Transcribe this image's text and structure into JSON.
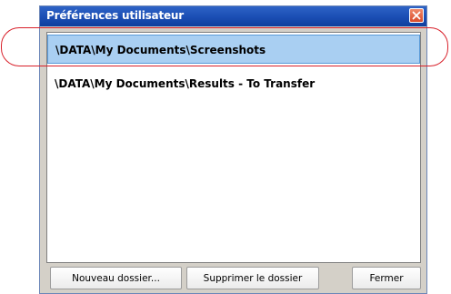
{
  "window": {
    "title": "Préférences utilisateur",
    "close_icon": "close-icon"
  },
  "folders": [
    {
      "path": "\\DATA\\My Documents\\Screenshots",
      "selected": true
    },
    {
      "path": "\\DATA\\My Documents\\Results - To Transfer",
      "selected": false
    }
  ],
  "buttons": {
    "new_folder": "Nouveau dossier...",
    "delete_folder": "Supprimer le dossier",
    "close": "Fermer"
  },
  "colors": {
    "titlebar": "#1c4fb5",
    "selection": "#a9cff2",
    "highlight_annotation": "#d8202a"
  }
}
